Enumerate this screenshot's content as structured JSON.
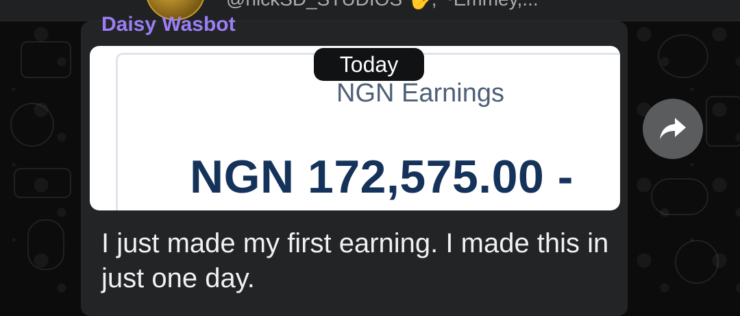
{
  "header": {
    "members": "@nickSD_STUDIOS 🖐, ~Emmey,..."
  },
  "message": {
    "sender": "Daisy Wasbot",
    "date_label": "Today",
    "image": {
      "title": "NGN Earnings",
      "amount": "NGN 172,575.00 -"
    },
    "caption": "I just made my first earning. I made this in just one day."
  },
  "icons": {
    "forward": "forward-arrow-icon",
    "avatar": "group-avatar"
  },
  "colors": {
    "sender_name": "#9b7ef5",
    "bubble": "#222426",
    "amount_text": "#15335a",
    "title_text": "#4d6078"
  }
}
